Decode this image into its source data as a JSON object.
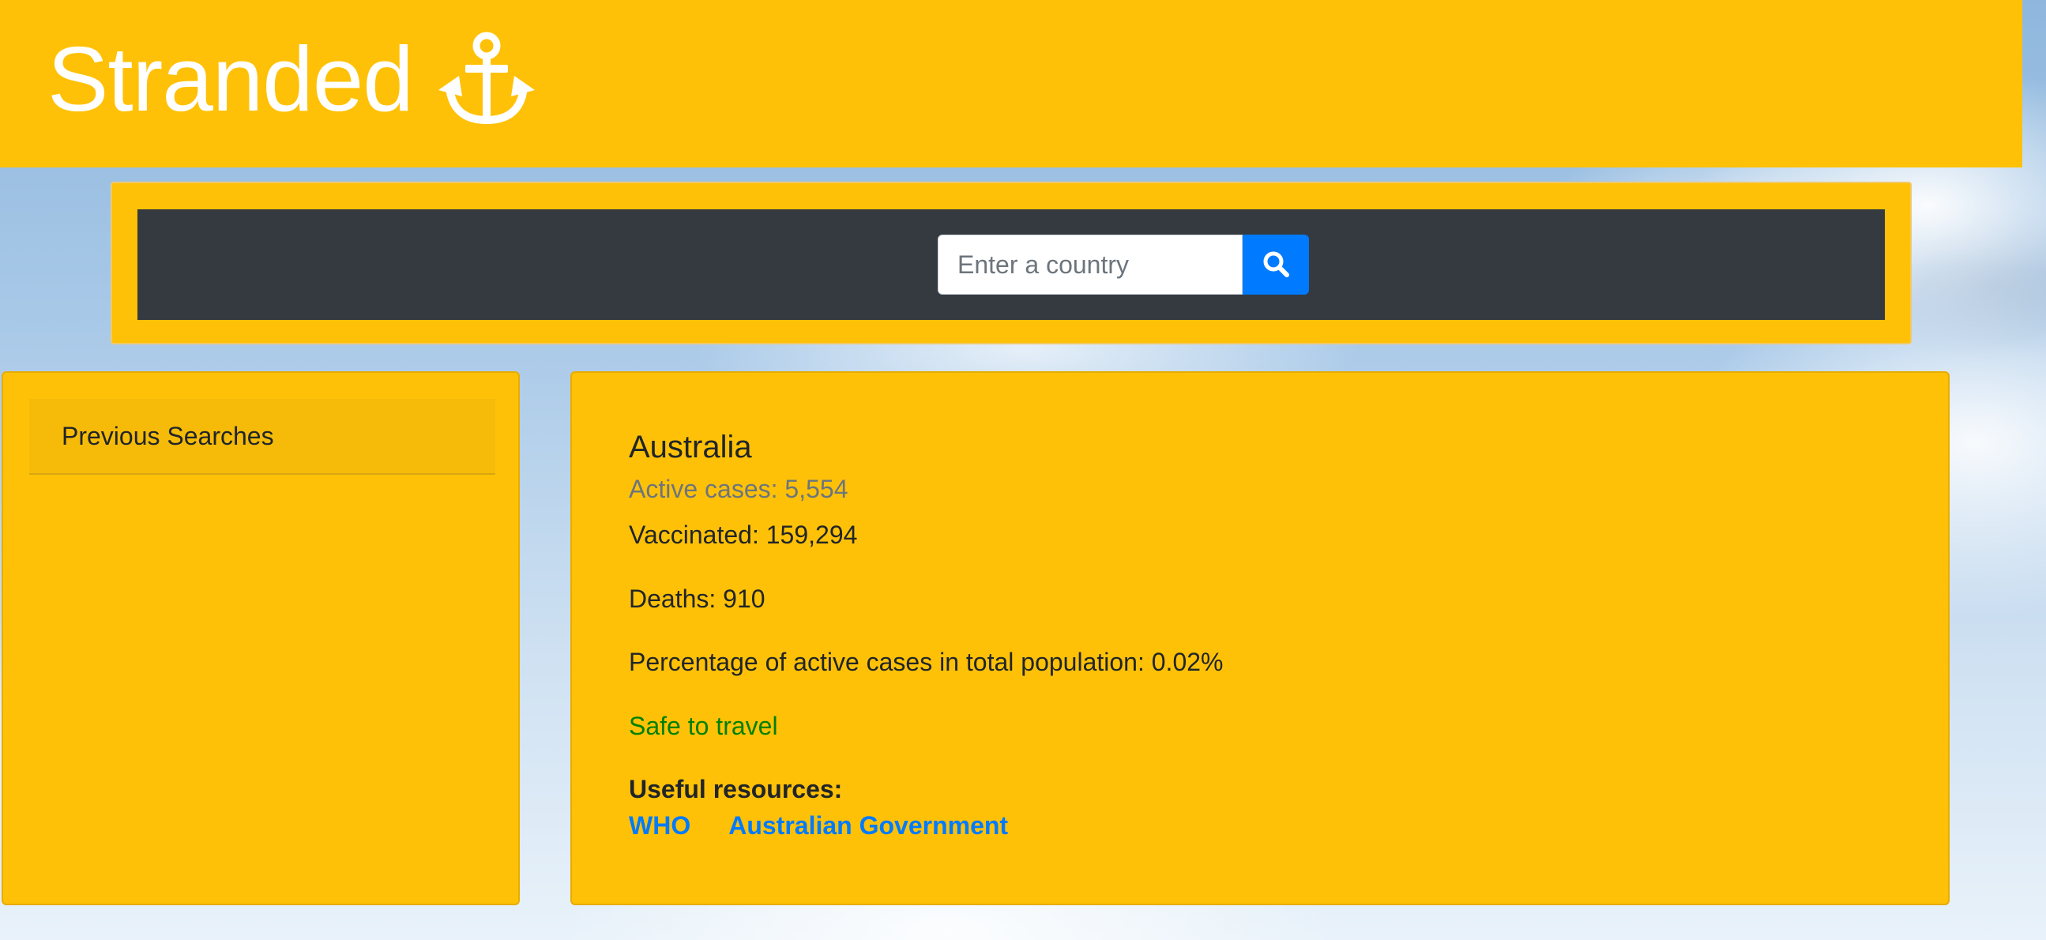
{
  "header": {
    "brand_title": "Stranded",
    "brand_icon": "anchor-icon",
    "background_color": "#ffc107"
  },
  "search": {
    "placeholder": "Enter a country",
    "value": "",
    "button_icon": "search-icon",
    "button_color": "#007bff"
  },
  "sidebar": {
    "title": "Previous Searches",
    "items": []
  },
  "result": {
    "country": "Australia",
    "active_cases": "Active cases: 5,554",
    "vaccinated": "Vaccinated: 159,294",
    "deaths": "Deaths: 910",
    "percentage": "Percentage of active cases in total population: 0.02%",
    "safety_status": "Safe to travel",
    "safety_color": "#008000",
    "resources_heading": "Useful resources:",
    "resources": [
      {
        "label": "WHO"
      },
      {
        "label": "Australian Government"
      }
    ]
  }
}
